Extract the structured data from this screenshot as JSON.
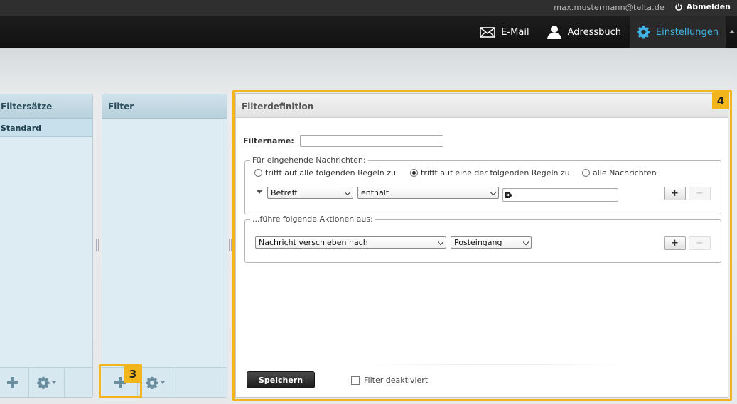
{
  "topbar": {
    "user": "max.mustermann@telta.de",
    "logout": "Abmelden"
  },
  "nav": {
    "items": [
      {
        "label": "E-Mail",
        "icon": "envelope-icon"
      },
      {
        "label": "Adressbuch",
        "icon": "person-icon"
      },
      {
        "label": "Einstellungen",
        "icon": "gear-icon",
        "active": true
      }
    ]
  },
  "filtersets": {
    "title": "Filtersätze",
    "items": [
      "Standard"
    ]
  },
  "filters": {
    "title": "Filter",
    "items": []
  },
  "definition": {
    "title": "Filterdefinition",
    "name_label": "Filtername:",
    "name_value": "",
    "incoming": {
      "legend": "Für eingehende Nachrichten:",
      "options": [
        "trifft auf alle folgenden Regeln zu",
        "trifft auf eine der folgenden Regeln zu",
        "alle Nachrichten"
      ],
      "selected_index": 1,
      "rule_field": "Betreff",
      "rule_op": "enthält",
      "rule_value": ""
    },
    "actions": {
      "legend": "...führe folgende Aktionen aus:",
      "action": "Nachricht verschieben nach",
      "target": "Posteingang"
    },
    "add_label": "+",
    "remove_label": "−",
    "save_label": "Speichern",
    "disable_label": "Filter deaktiviert"
  },
  "callouts": {
    "add_filter": "3",
    "definition": "4",
    "color": "#f2b51b"
  },
  "colors": {
    "accent": "#3fb3e6",
    "header": "#111111",
    "panel": "#ddebf2"
  }
}
